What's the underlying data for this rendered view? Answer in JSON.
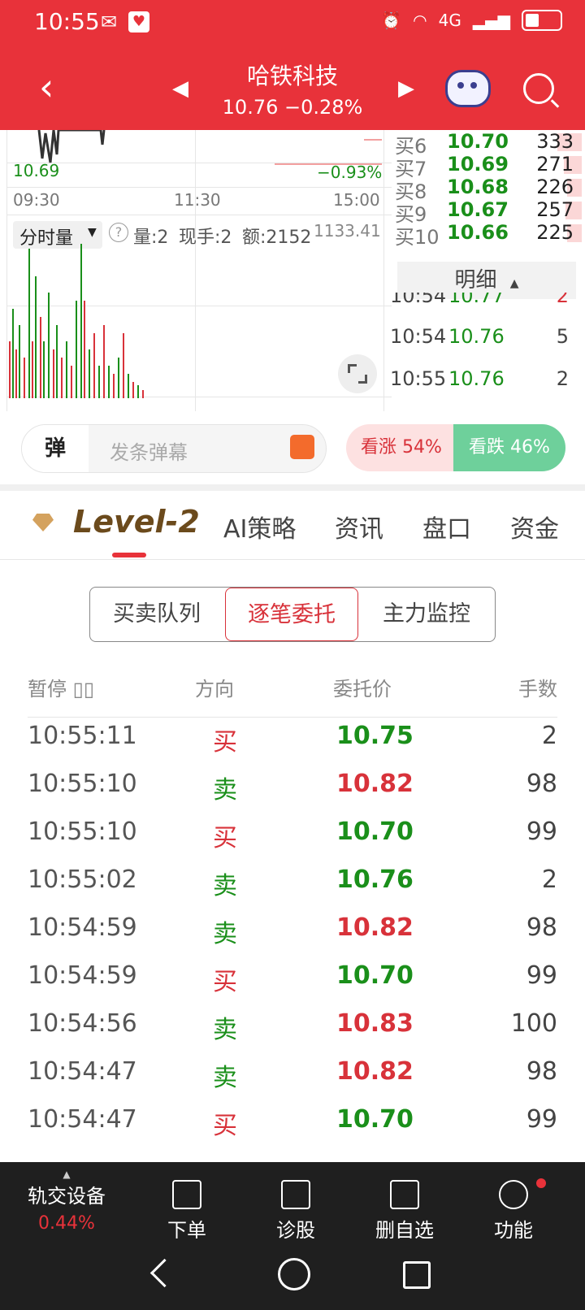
{
  "statusbar": {
    "time": "10:55",
    "wechat_icon": "wechat-icon",
    "network": "4G"
  },
  "header": {
    "stock_name": "哈铁科技",
    "quote": "10.76  −0.28%"
  },
  "chart": {
    "price_label": "10.69",
    "pct_label": "−0.93%",
    "times": [
      "09:30",
      "11:30",
      "15:00"
    ],
    "vol_selector": "分时量",
    "vol_info": {
      "vol": "量:2",
      "hand": "现手:2",
      "amount": "额:2152"
    },
    "vol_max": "1133.41"
  },
  "orderbook": {
    "bids": [
      {
        "label": "买6",
        "price": "10.70",
        "qty": "333"
      },
      {
        "label": "买7",
        "price": "10.69",
        "qty": "271"
      },
      {
        "label": "买8",
        "price": "10.68",
        "qty": "226"
      },
      {
        "label": "买9",
        "price": "10.67",
        "qty": "257"
      },
      {
        "label": "买10",
        "price": "10.66",
        "qty": "225"
      }
    ],
    "detail_header": "明细",
    "ticks": [
      {
        "time": "10:54",
        "price": "10.77",
        "qty": "2"
      },
      {
        "time": "10:54",
        "price": "10.76",
        "qty": "5"
      },
      {
        "time": "10:55",
        "price": "10.76",
        "qty": "2"
      }
    ]
  },
  "danmaku": {
    "badge": "弹",
    "placeholder": "发条弹幕",
    "bull": "看涨 54%",
    "bear": "看跌 46%"
  },
  "tabs": [
    "Level-2",
    "AI策略",
    "资讯",
    "盘口",
    "资金"
  ],
  "segments": [
    "买卖队列",
    "逐笔委托",
    "主力监控"
  ],
  "table": {
    "headers": [
      "暂停 ▯▯",
      "方向",
      "委托价",
      "手数"
    ],
    "rows": [
      {
        "time": "10:55:11",
        "dir": "买",
        "price": "10.75",
        "qty": "2",
        "price_color": "green",
        "dir_color": "red"
      },
      {
        "time": "10:55:10",
        "dir": "卖",
        "price": "10.82",
        "qty": "98",
        "price_color": "red",
        "dir_color": "green"
      },
      {
        "time": "10:55:10",
        "dir": "买",
        "price": "10.70",
        "qty": "99",
        "price_color": "green",
        "dir_color": "red"
      },
      {
        "time": "10:55:02",
        "dir": "卖",
        "price": "10.76",
        "qty": "2",
        "price_color": "green",
        "dir_color": "green"
      },
      {
        "time": "10:54:59",
        "dir": "卖",
        "price": "10.82",
        "qty": "98",
        "price_color": "red",
        "dir_color": "green"
      },
      {
        "time": "10:54:59",
        "dir": "买",
        "price": "10.70",
        "qty": "99",
        "price_color": "green",
        "dir_color": "red"
      },
      {
        "time": "10:54:56",
        "dir": "卖",
        "price": "10.83",
        "qty": "100",
        "price_color": "red",
        "dir_color": "green"
      },
      {
        "time": "10:54:47",
        "dir": "卖",
        "price": "10.82",
        "qty": "98",
        "price_color": "red",
        "dir_color": "green"
      },
      {
        "time": "10:54:47",
        "dir": "买",
        "price": "10.70",
        "qty": "99",
        "price_color": "green",
        "dir_color": "red"
      }
    ]
  },
  "bottombar": {
    "sector": "轨交设备",
    "sector_pct": "0.44%",
    "items": [
      "下单",
      "诊股",
      "删自选",
      "功能"
    ]
  },
  "colors": {
    "brand": "#e8323a",
    "up": "#d8323a",
    "down": "#1a8f1a"
  }
}
